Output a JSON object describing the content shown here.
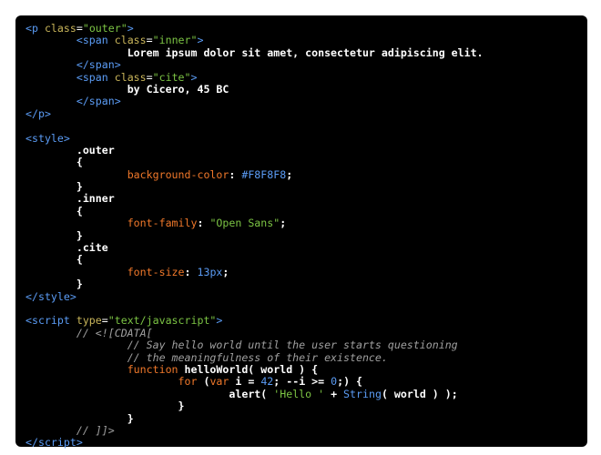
{
  "code_lines": [
    [
      [
        "tag",
        "<p "
      ],
      [
        "attr",
        "class"
      ],
      [
        "plain",
        "="
      ],
      [
        "str",
        "\"outer\""
      ],
      [
        "tag",
        ">"
      ]
    ],
    [
      [
        "plain",
        "\t"
      ],
      [
        "tag",
        "<span "
      ],
      [
        "attr",
        "class"
      ],
      [
        "plain",
        "="
      ],
      [
        "str",
        "\"inner\""
      ],
      [
        "tag",
        ">"
      ]
    ],
    [
      [
        "plain",
        "\t\t"
      ],
      [
        "txt",
        "Lorem ipsum dolor sit amet, consectetur adipiscing elit."
      ]
    ],
    [
      [
        "plain",
        "\t"
      ],
      [
        "tag",
        "</span>"
      ]
    ],
    [
      [
        "plain",
        "\t"
      ],
      [
        "tag",
        "<span "
      ],
      [
        "attr",
        "class"
      ],
      [
        "plain",
        "="
      ],
      [
        "str",
        "\"cite\""
      ],
      [
        "tag",
        ">"
      ]
    ],
    [
      [
        "plain",
        "\t\t"
      ],
      [
        "txt",
        "by Cicero, 45 BC"
      ]
    ],
    [
      [
        "plain",
        "\t"
      ],
      [
        "tag",
        "</span>"
      ]
    ],
    [
      [
        "tag",
        "</p>"
      ]
    ],
    [],
    [
      [
        "tag",
        "<style>"
      ]
    ],
    [
      [
        "plain",
        "\t"
      ],
      [
        "txt",
        ".outer"
      ]
    ],
    [
      [
        "plain",
        "\t"
      ],
      [
        "txt",
        "{"
      ]
    ],
    [
      [
        "plain",
        "\t\t"
      ],
      [
        "prop",
        "background-color"
      ],
      [
        "txt",
        ": "
      ],
      [
        "num",
        "#F8F8F8"
      ],
      [
        "txt",
        ";"
      ]
    ],
    [
      [
        "plain",
        "\t"
      ],
      [
        "txt",
        "}"
      ]
    ],
    [
      [
        "plain",
        "\t"
      ],
      [
        "txt",
        ".inner"
      ]
    ],
    [
      [
        "plain",
        "\t"
      ],
      [
        "txt",
        "{"
      ]
    ],
    [
      [
        "plain",
        "\t\t"
      ],
      [
        "prop",
        "font-family"
      ],
      [
        "txt",
        ": "
      ],
      [
        "str",
        "\"Open Sans\""
      ],
      [
        "txt",
        ";"
      ]
    ],
    [
      [
        "plain",
        "\t"
      ],
      [
        "txt",
        "}"
      ]
    ],
    [
      [
        "plain",
        "\t"
      ],
      [
        "txt",
        ".cite"
      ]
    ],
    [
      [
        "plain",
        "\t"
      ],
      [
        "txt",
        "{"
      ]
    ],
    [
      [
        "plain",
        "\t\t"
      ],
      [
        "prop",
        "font-size"
      ],
      [
        "txt",
        ": "
      ],
      [
        "num",
        "13px"
      ],
      [
        "txt",
        ";"
      ]
    ],
    [
      [
        "plain",
        "\t"
      ],
      [
        "txt",
        "}"
      ]
    ],
    [
      [
        "tag",
        "</style>"
      ]
    ],
    [],
    [
      [
        "tag",
        "<script "
      ],
      [
        "attr",
        "type"
      ],
      [
        "plain",
        "="
      ],
      [
        "str",
        "\"text/javascript\""
      ],
      [
        "tag",
        ">"
      ]
    ],
    [
      [
        "plain",
        "\t"
      ],
      [
        "com",
        "// <![CDATA["
      ]
    ],
    [
      [
        "plain",
        "\t\t"
      ],
      [
        "com",
        "// Say hello world until the user starts questioning"
      ]
    ],
    [
      [
        "plain",
        "\t\t"
      ],
      [
        "com",
        "// the meaningfulness of their existence."
      ]
    ],
    [
      [
        "plain",
        "\t\t"
      ],
      [
        "kw",
        "function"
      ],
      [
        "txt",
        " helloWorld( world ) {"
      ]
    ],
    [
      [
        "plain",
        "\t\t\t"
      ],
      [
        "kw",
        "for"
      ],
      [
        "txt",
        " ("
      ],
      [
        "kw",
        "var"
      ],
      [
        "txt",
        " i = "
      ],
      [
        "num",
        "42"
      ],
      [
        "txt",
        "; --i >= "
      ],
      [
        "num",
        "0"
      ],
      [
        "txt",
        ";) {"
      ]
    ],
    [
      [
        "plain",
        "\t\t\t\t"
      ],
      [
        "txt",
        "alert( "
      ],
      [
        "str",
        "'Hello '"
      ],
      [
        "txt",
        " + "
      ],
      [
        "type",
        "String"
      ],
      [
        "txt",
        "( world ) );"
      ]
    ],
    [
      [
        "plain",
        "\t\t\t"
      ],
      [
        "txt",
        "}"
      ]
    ],
    [
      [
        "plain",
        "\t\t"
      ],
      [
        "txt",
        "}"
      ]
    ],
    [
      [
        "plain",
        "\t"
      ],
      [
        "com",
        "// ]]>"
      ]
    ],
    [
      [
        "tag",
        "</script>"
      ]
    ]
  ],
  "colors": {
    "background": "#000000",
    "tag": "#5b9cf5",
    "attribute": "#c9b55a",
    "string": "#7cc444",
    "keyword": "#f0782a",
    "comment": "#a0a0a0",
    "text": "#ffffff"
  }
}
